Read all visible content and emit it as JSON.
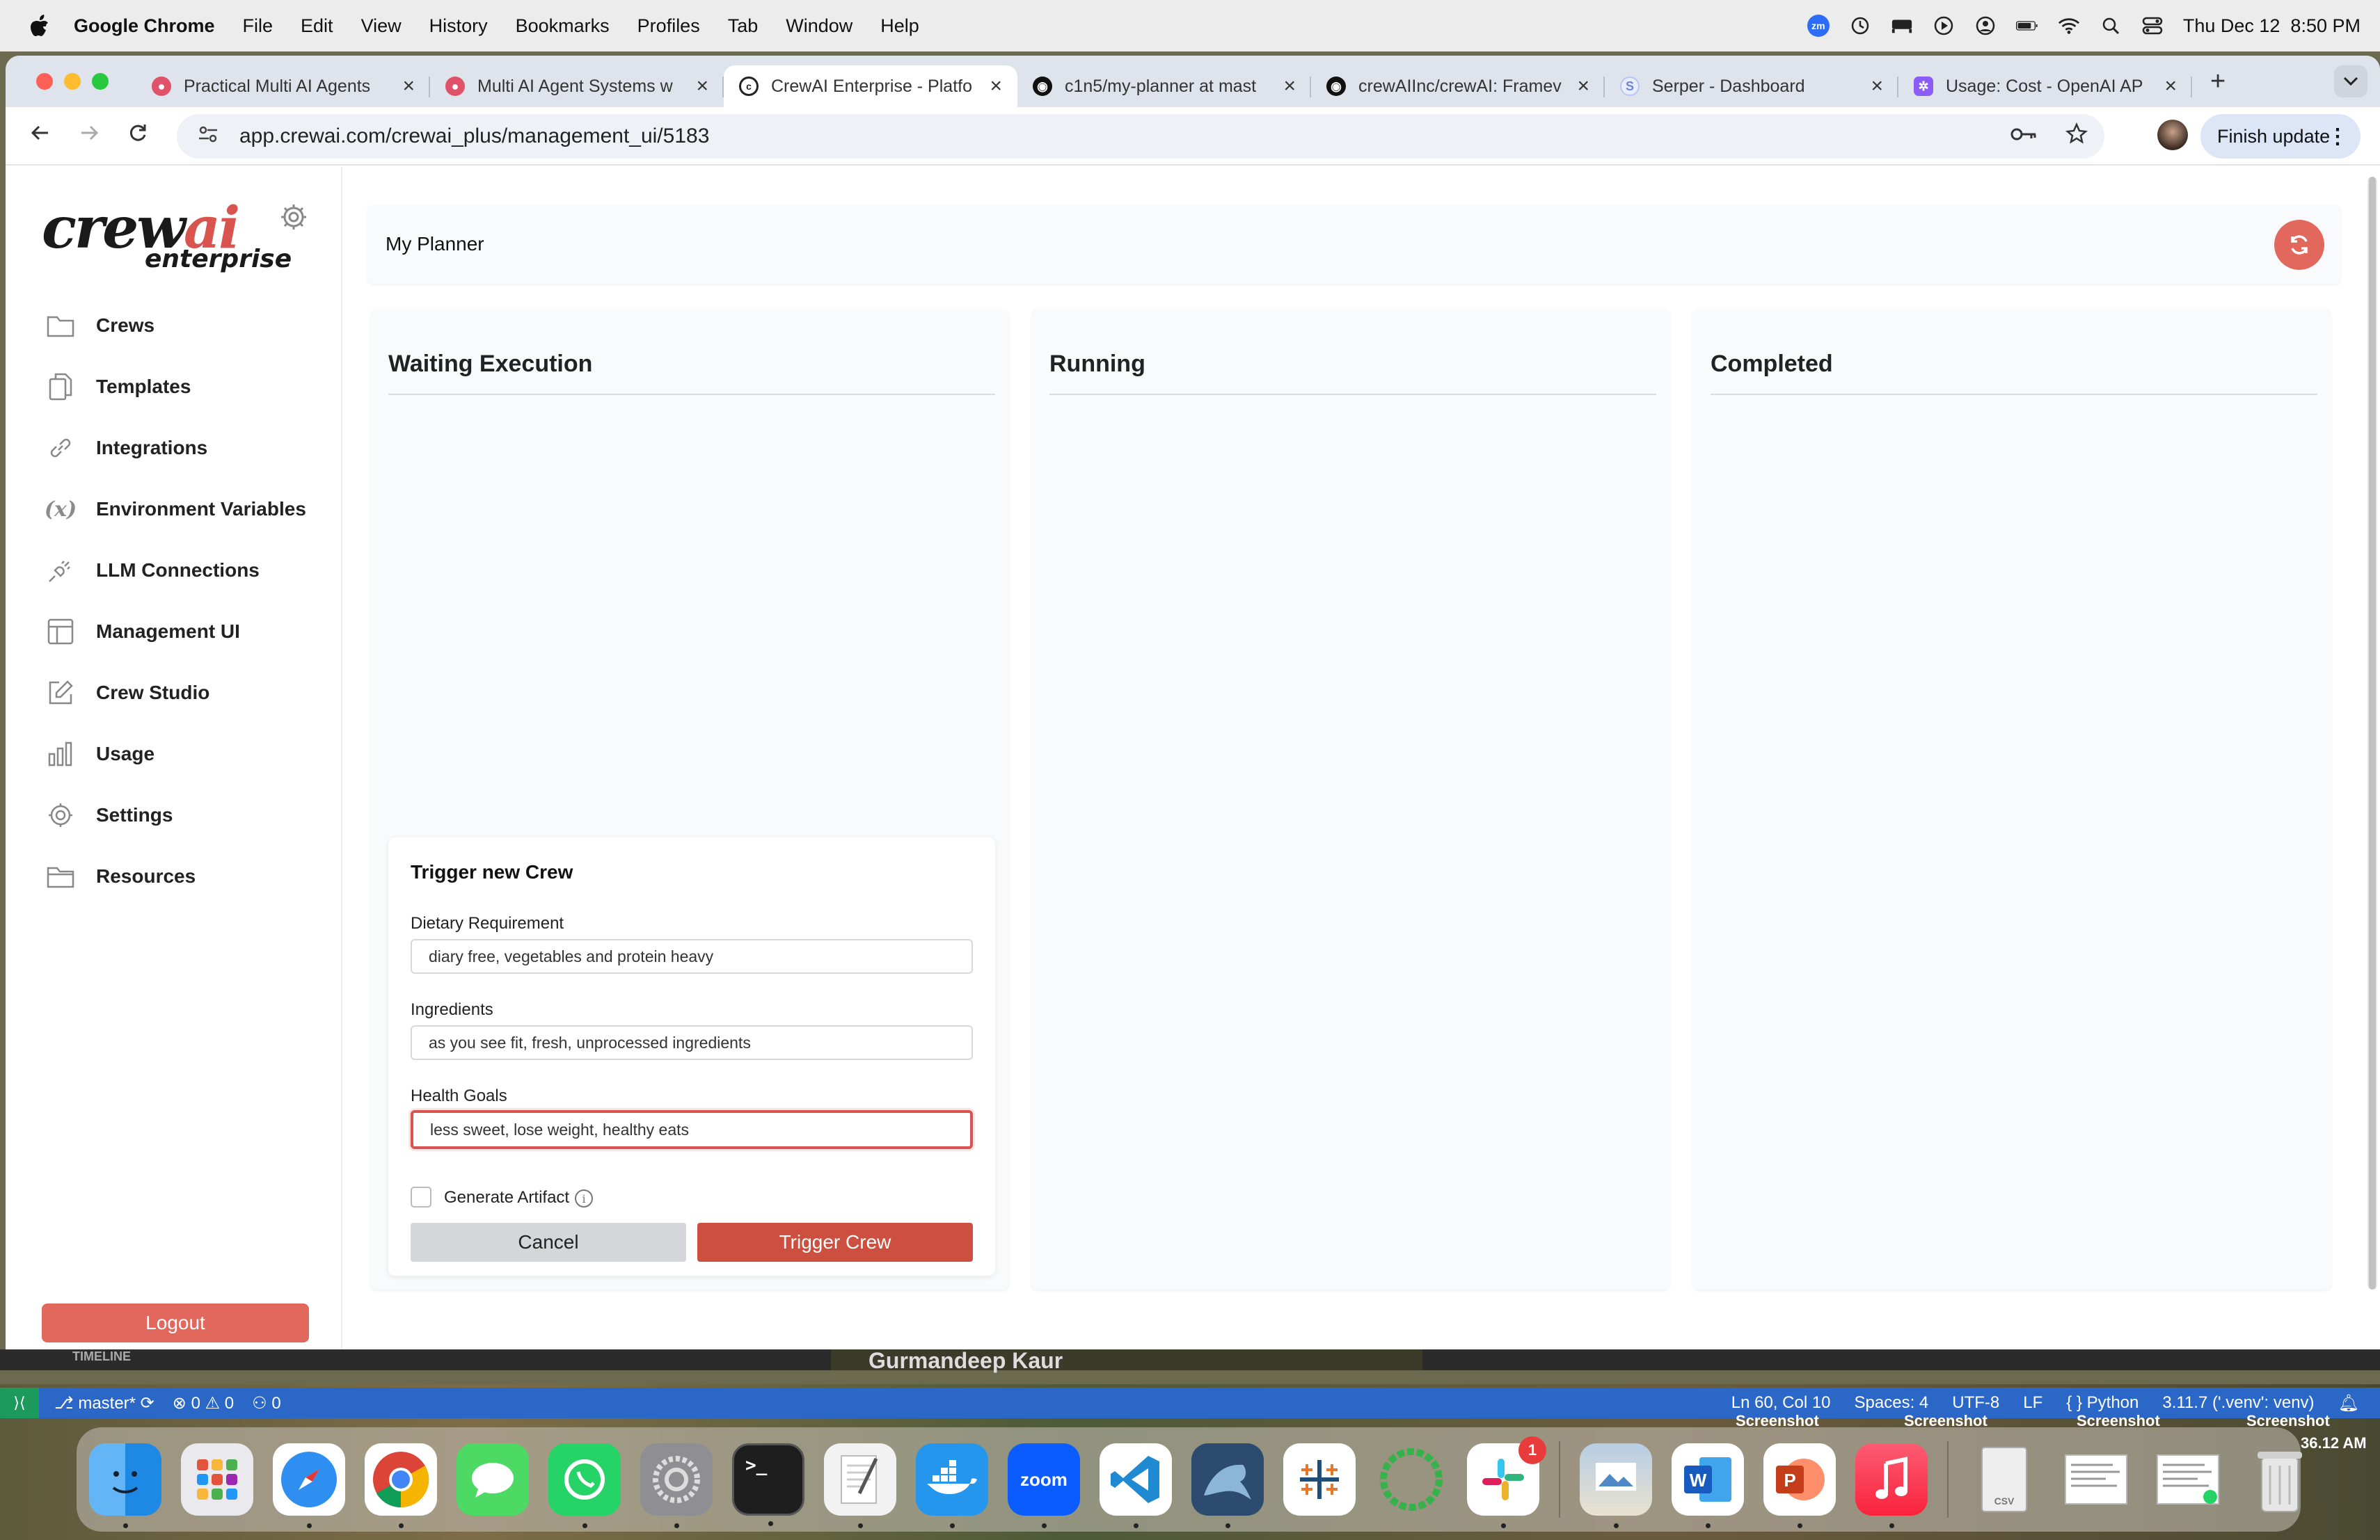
{
  "menubar": {
    "app_name": "Google Chrome",
    "items": [
      "File",
      "Edit",
      "View",
      "History",
      "Bookmarks",
      "Profiles",
      "Tab",
      "Window",
      "Help"
    ],
    "clock": "Thu Dec 12  8:50 PM",
    "zoom_badge": "zm"
  },
  "browser": {
    "tabs": [
      {
        "title": "Practical Multi AI Agents",
        "favicon_color": "#e0516a",
        "favicon": "course-icon"
      },
      {
        "title": "Multi AI Agent Systems w",
        "favicon_color": "#e0516a",
        "favicon": "course-icon"
      },
      {
        "title": "CrewAI Enterprise - Platfo",
        "favicon_color": "#222222",
        "favicon": "crewai-icon",
        "active": true
      },
      {
        "title": "c1n5/my-planner at mast",
        "favicon_color": "#111111",
        "favicon": "github-icon"
      },
      {
        "title": "crewAIInc/crewAI: Framev",
        "favicon_color": "#111111",
        "favicon": "github-icon"
      },
      {
        "title": "Serper - Dashboard",
        "favicon_color": "#b8c6f5",
        "favicon": "serper-icon"
      },
      {
        "title": "Usage: Cost - OpenAI AP",
        "favicon_color": "#8b5cf6",
        "favicon": "openai-icon"
      }
    ],
    "new_tab": "+",
    "url": "app.crewai.com/crewai_plus/management_ui/5183",
    "finish_update": "Finish update"
  },
  "sidebar": {
    "logo_crew": "crew",
    "logo_ai": "ai",
    "logo_sub": "enterprise",
    "items": [
      {
        "label": "Crews",
        "icon": "folder-icon"
      },
      {
        "label": "Templates",
        "icon": "copy-icon"
      },
      {
        "label": "Integrations",
        "icon": "link-icon"
      },
      {
        "label": "Environment Variables",
        "icon": "variable-icon"
      },
      {
        "label": "LLM Connections",
        "icon": "plug-icon"
      },
      {
        "label": "Management UI",
        "icon": "layout-icon"
      },
      {
        "label": "Crew Studio",
        "icon": "edit-icon"
      },
      {
        "label": "Usage",
        "icon": "bar-chart-icon"
      },
      {
        "label": "Settings",
        "icon": "gear-icon"
      },
      {
        "label": "Resources",
        "icon": "folder-icon"
      }
    ],
    "logout": "Logout"
  },
  "main": {
    "title": "My Planner",
    "columns": [
      "Waiting Execution",
      "Running",
      "Completed"
    ]
  },
  "trigger_form": {
    "title": "Trigger new Crew",
    "fields": [
      {
        "label": "Dietary Requirement",
        "value": "diary free, vegetables and protein heavy"
      },
      {
        "label": "Ingredients",
        "value": "as you see fit, fresh, unprocessed ingredients"
      },
      {
        "label": "Health Goals",
        "value": "less sweet, lose weight, healthy eats"
      }
    ],
    "generate_artifact": "Generate Artifact",
    "info": "i",
    "cancel": "Cancel",
    "trigger": "Trigger Crew"
  },
  "vscode_status": {
    "branch": "master*",
    "errors": "0",
    "warnings": "0",
    "ports": "0",
    "timeline": "TIMELINE",
    "video_title": "Gurmandeep Kaur",
    "position": "Ln 60, Col 10",
    "spaces": "Spaces: 4",
    "encoding": "UTF-8",
    "eol": "LF",
    "language": "Python",
    "interpreter": "3.11.7 ('.venv': venv)"
  },
  "desktop": {
    "screenshot_labels": [
      "Screenshot",
      "Screenshot",
      "Screenshot",
      "Screenshot"
    ],
    "clock_fragment": "36.12 AM"
  },
  "dock": {
    "apps": [
      {
        "name": "finder-icon",
        "color": "#3d8ef0"
      },
      {
        "name": "launchpad-icon",
        "color": "#e9e9ee"
      },
      {
        "name": "safari-icon",
        "color": "#2f8ff0"
      },
      {
        "name": "chrome-icon",
        "color": "#ffffff"
      },
      {
        "name": "messages-icon",
        "color": "#4cd964"
      },
      {
        "name": "whatsapp-icon",
        "color": "#25d366"
      },
      {
        "name": "system-settings-icon",
        "color": "#8e8e93"
      },
      {
        "name": "terminal-icon",
        "color": "#1e1e1e"
      },
      {
        "name": "textedit-icon",
        "color": "#f2f2f2"
      },
      {
        "name": "docker-icon",
        "color": "#2496ed"
      },
      {
        "name": "zoom-icon",
        "color": "#0b5cff"
      },
      {
        "name": "vscode-icon",
        "color": "#ffffff"
      },
      {
        "name": "mysql-workbench-icon",
        "color": "#2c4b6e"
      },
      {
        "name": "tableau-icon",
        "color": "#ffffff"
      },
      {
        "name": "activity-ring-icon",
        "color": "#36b24a"
      },
      {
        "name": "slack-icon",
        "color": "#ffffff"
      },
      {
        "name": "preview-icon",
        "color": "#7fa7d6"
      },
      {
        "name": "word-icon",
        "color": "#2b579a"
      },
      {
        "name": "powerpoint-icon",
        "color": "#d24726"
      },
      {
        "name": "music-icon",
        "color": "#fa2d48"
      },
      {
        "name": "csv-file-icon",
        "color": "#eeeeee"
      },
      {
        "name": "screenshot-stack-icon",
        "color": "#f4f4f4"
      },
      {
        "name": "screenshot-stack-2-icon",
        "color": "#f4f4f4"
      },
      {
        "name": "trash-icon",
        "color": "#d9d9d9"
      }
    ],
    "zoom_label": "zoom",
    "slack_badge": "1"
  },
  "colors": {
    "accent": "#cd4f3f",
    "logout": "#e2675c",
    "focus_border": "#d9534f"
  }
}
